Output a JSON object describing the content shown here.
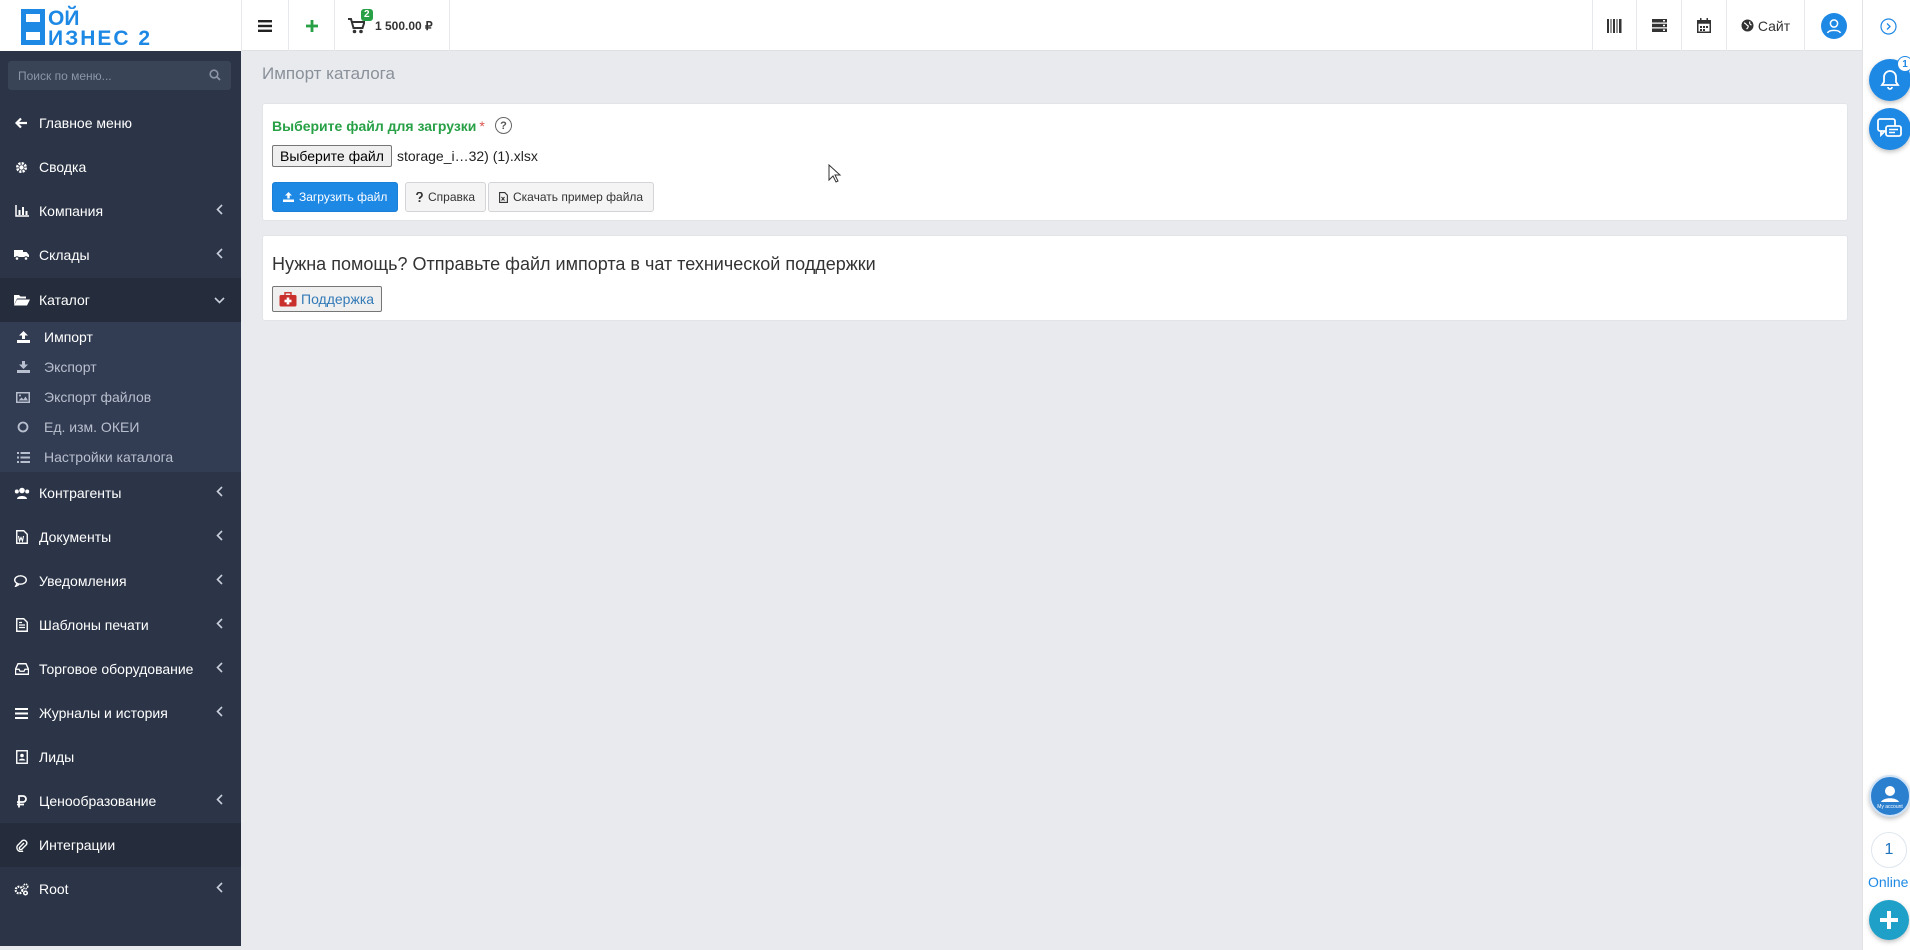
{
  "logo": {
    "line1": "ОЙ",
    "line2": "ИЗНЕС 2"
  },
  "header": {
    "cart_badge": "2",
    "cart_total": "1 500.00 ₽",
    "site_label": "Сайт"
  },
  "sidebar": {
    "search_placeholder": "Поиск по меню...",
    "items": [
      {
        "label": "Главное меню"
      },
      {
        "label": "Сводка"
      },
      {
        "label": "Компания"
      },
      {
        "label": "Склады"
      },
      {
        "label": "Каталог"
      },
      {
        "label": "Контрагенты"
      },
      {
        "label": "Документы"
      },
      {
        "label": "Уведомления"
      },
      {
        "label": "Шаблоны печати"
      },
      {
        "label": "Торговое оборудование"
      },
      {
        "label": "Журналы и история"
      },
      {
        "label": "Лиды"
      },
      {
        "label": "Ценообразование"
      },
      {
        "label": "Интеграции"
      },
      {
        "label": "Root"
      }
    ],
    "catalog_sub": [
      {
        "label": "Импорт"
      },
      {
        "label": "Экспорт"
      },
      {
        "label": "Экспорт файлов"
      },
      {
        "label": "Ед. изм. ОКЕИ"
      },
      {
        "label": "Настройки каталога"
      }
    ]
  },
  "main": {
    "page_title": "Импорт каталога",
    "file_label": "Выберите файл для загрузки",
    "required_mark": "*",
    "help_mark": "?",
    "choose_file_btn": "Выберите файл",
    "file_name": "storage_i…32) (1).xlsx",
    "upload_btn": "Загрузить файл",
    "help_btn": "Справка",
    "download_example_btn": "Скачать пример файла",
    "support_text": "Нужна помощь? Отправьте файл импорта в чат технической поддержки",
    "support_btn": "Поддержка"
  },
  "right_panel": {
    "notifications_badge": "1",
    "account_label": "My account",
    "online_count": "1",
    "online_label": "Online"
  },
  "colors": {
    "sidebar_bg": "#2c3547",
    "accent_blue": "#1e88e5",
    "accent_green": "#27a046",
    "content_bg": "#e8eaee"
  }
}
